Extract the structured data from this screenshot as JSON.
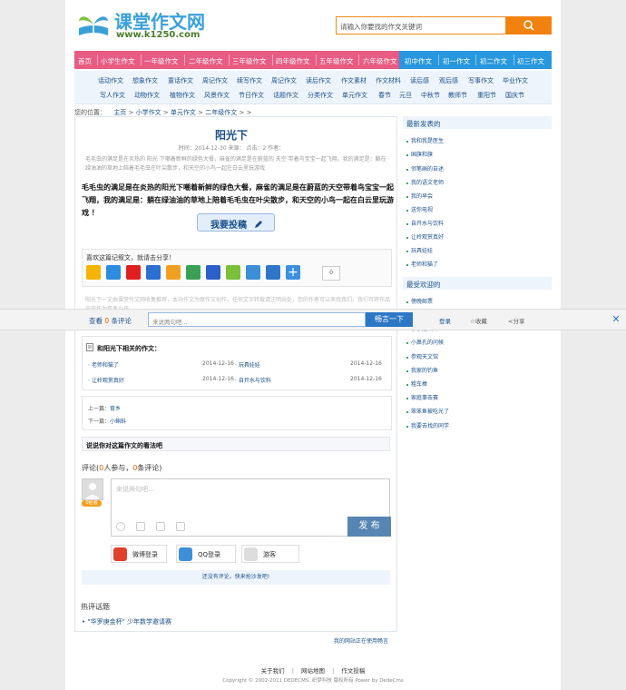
{
  "header": {
    "logo_title": "课堂作文网",
    "logo_url": "www.k1250.com",
    "search_placeholder": "请输入你要找的作文关键词"
  },
  "nav": {
    "pink_items": [
      "首页",
      "小学生作文",
      "一年级作文",
      "二年级作文",
      "三年级作文",
      "四年级作文",
      "五年级作文",
      "六年级作文"
    ],
    "blue_items": [
      "初中作文",
      "初一作文",
      "初二作文",
      "初三作文"
    ]
  },
  "subnav": {
    "row1": [
      "话动作文",
      "想象作文",
      "童话作文",
      "周记作文",
      "续写作文",
      "周记作文",
      "读后作文",
      "作文素材",
      "作文材料",
      "读后感",
      "观后感",
      "写事作文",
      "毕业作文"
    ],
    "row2": [
      "写人作文",
      "动物作文",
      "植物作文",
      "风景作文",
      "节日作文",
      "话题作文",
      "分类作文",
      "单元作文",
      "春节",
      "元旦",
      "中秋节",
      "教师节",
      "重阳节",
      "国庆节"
    ]
  },
  "breadcrumb": [
    "您的位置：",
    "主页",
    ">",
    "小学作文",
    ">",
    "单元作文",
    ">",
    "二年级作文",
    ">",
    ">"
  ],
  "article": {
    "title": "阳光下",
    "meta": "时间：2014-12-30  来源：    点击：2  作者：",
    "summary": "毛毛虫的满足是在炎热的 阳光 下嘲着新鲜的绿色大餐，麻雀的满足是在蔚蓝的 天空 带着鸟宝宝一起飞翔，我的满足是：躺在绿油油的草地上陪着毛毛虫在叶尖散步，和天空的小鸟一起在白云里玩游戏",
    "body": "毛毛虫的满足是在炎热的阳光下嘲着新鲜的绿色大餐，麻雀的满足是在蔚蓝的天空带着鸟宝宝一起飞翔，我的满足是：躺在绿油油的草地上陪着毛毛虫在叶尖散步，和天空的小鸟一起在白云里玩游戏 ！",
    "submit_label": "我要投稿"
  },
  "share": {
    "title": "喜欢这篇记叙文，就请击分享！",
    "count": "0"
  },
  "faint_text": "阳光下一文由课堂作文网收集推荐，本站作文为原作文创作，任何文字转载请注明出处，您的作者可以来找我们，我们可将作品内容作为参考小孩...",
  "comment_bar": {
    "view": "查看",
    "view_count": "0",
    "view_suffix": "条评论",
    "input_placeholder": "来说两句吧...",
    "submit": "畅言一下",
    "login": "登录",
    "favorite": "收藏",
    "share": "分享"
  },
  "related": {
    "heading": "和阳光下相关的作文：",
    "items": [
      {
        "title": "老师和猫了",
        "date": "2014-12-16",
        "title2": "玩具娃娃",
        "date2": "2014-12-16"
      },
      {
        "title": "让岭观赏真好",
        "date": "2014-12-16",
        "title2": "自开水与饮料",
        "date2": "2014-12-16"
      }
    ]
  },
  "prevnext": {
    "prev_label": "上一篇：",
    "prev": "育乡",
    "next_label": "下一篇：",
    "next": "小蝌蚪"
  },
  "opinion_title": "说说你对这篇作文的看法吧",
  "comments": {
    "prefix": "评论(",
    "participants": "0",
    "mid": "人参与，",
    "count": "0",
    "suffix": "条评论)",
    "placeholder": "来说两句吧...",
    "publish": "发 布",
    "badge": "0经验",
    "login_weibo": "微博登录",
    "login_qq": "QQ登录",
    "login_guest": "游客",
    "notice": "还没有评论，快来抢沙发吧!"
  },
  "hot": {
    "title": "热评话题",
    "item": "\"华罗庚金杯\" 少年数学邀请赛"
  },
  "site_link": "我的网站正在使用畅言",
  "sidebar": {
    "latest_title": "最新发表的",
    "latest": [
      "我和我是医生",
      "国旗和旗",
      "邻笔画的自述",
      "我的语文老师",
      "我的早会",
      "送你电视",
      "自开水与饮料",
      "让岭观赏真好",
      "玩具娃娃",
      "老师和猫了"
    ],
    "popular_title": "最受欢迎的",
    "popular": [
      "傍晚邮票",
      "小小建筑师",
      "小鼻孔的问候",
      "参观天文馆",
      "我家的钓鱼",
      "粗车棒",
      "家庭事击赛",
      "笨笨鱼被吃光了",
      "我要去找的同学"
    ]
  },
  "footer": {
    "links": [
      "关于我们",
      "|",
      "网站地图",
      "|",
      "作文投稿"
    ],
    "copyright": "Copyright © 2002-2011 DEDECMS. 织梦科技 版权所有 Power by DedeCms"
  },
  "colors": {
    "nav_pink": "#e85b82",
    "nav_blue": "#2797de",
    "accent_orange": "#f2820e",
    "link_blue": "#1a4f8b"
  }
}
